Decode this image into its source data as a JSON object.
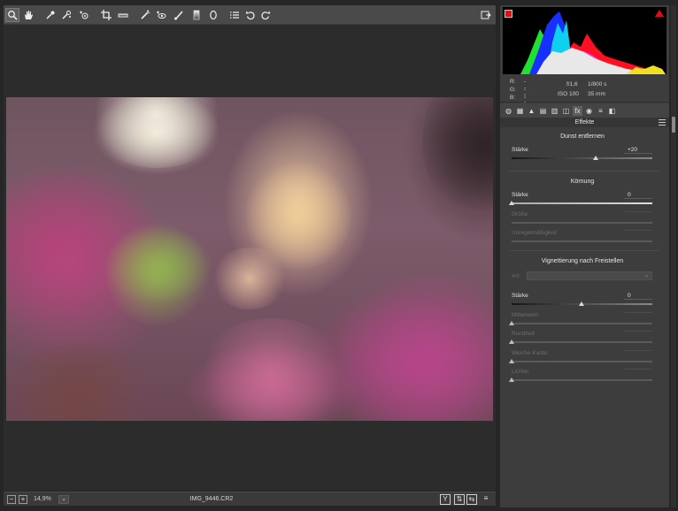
{
  "toolbar": {
    "tools": [
      {
        "name": "zoom-tool",
        "icon": "magnifier-icon"
      },
      {
        "name": "hand-tool",
        "icon": "hand-icon"
      },
      {
        "name": "white-balance-tool",
        "icon": "eyedropper-icon"
      },
      {
        "name": "color-sampler-tool",
        "icon": "color-sampler-icon"
      },
      {
        "name": "targeted-adjustment-tool",
        "icon": "target-adjust-icon"
      },
      {
        "name": "crop-tool",
        "icon": "crop-icon"
      },
      {
        "name": "straighten-tool",
        "icon": "straighten-icon"
      },
      {
        "name": "spot-removal-tool",
        "icon": "spot-removal-icon"
      },
      {
        "name": "red-eye-tool",
        "icon": "red-eye-icon"
      },
      {
        "name": "adjustment-brush-tool",
        "icon": "brush-icon"
      },
      {
        "name": "graduated-filter-tool",
        "icon": "graduated-filter-icon"
      },
      {
        "name": "radial-filter-tool",
        "icon": "radial-filter-icon"
      },
      {
        "name": "preferences-tool",
        "icon": "list-icon"
      },
      {
        "name": "rotate-left-tool",
        "icon": "rotate-ccw-icon"
      },
      {
        "name": "rotate-right-tool",
        "icon": "rotate-cw-icon"
      }
    ],
    "fullscreen_icon": "fullscreen-icon"
  },
  "statusbar": {
    "zoom_minus": "−",
    "zoom_plus": "+",
    "zoom": "14,9%",
    "zoom_dropdown": "⌄",
    "filename": "IMG_9446.CR2",
    "view_buttons": [
      "Y",
      "⇅",
      "⇆",
      "≡"
    ]
  },
  "info": {
    "r_label": "R:",
    "r_value": "---",
    "g_label": "G:",
    "g_value": "---",
    "b_label": "B:",
    "b_value": "---",
    "aperture": "f/1,6",
    "shutter": "1/800 s",
    "iso": "ISO 100",
    "focal": "35 mm"
  },
  "panel": {
    "tab_icons": [
      "◍",
      "▦",
      "▲",
      "▤",
      "▥",
      "◫",
      "fx",
      "◉",
      "≡",
      "◧"
    ],
    "header": "Effekte"
  },
  "dehaze": {
    "title": "Dunst entfernen",
    "amount_label": "Stärke",
    "amount_value": "+20",
    "amount": 20
  },
  "grain": {
    "title": "Körnung",
    "amount_label": "Stärke",
    "amount_value": "0",
    "size_label": "Größe",
    "size_value": "",
    "roughness_label": "Unregelmäßigkeit",
    "roughness_value": ""
  },
  "vignette": {
    "title": "Vignettierung nach Freistellen",
    "style_label": "Art:",
    "style_value": "",
    "amount_label": "Stärke",
    "amount_value": "0",
    "midpoint_label": "Mittenwert",
    "midpoint_value": "",
    "roundness_label": "Rundheit",
    "roundness_value": "",
    "feather_label": "Weiche Kante",
    "feather_value": "",
    "highlights_label": "Lichter",
    "highlights_value": ""
  },
  "colors": {
    "panel_bg": "#3d3d3d",
    "toolbar_bg": "#4a4a4a",
    "canvas_bg": "#2c2c2c",
    "shadow_clip": "#e01010",
    "highlight_clip": "#e01010"
  }
}
